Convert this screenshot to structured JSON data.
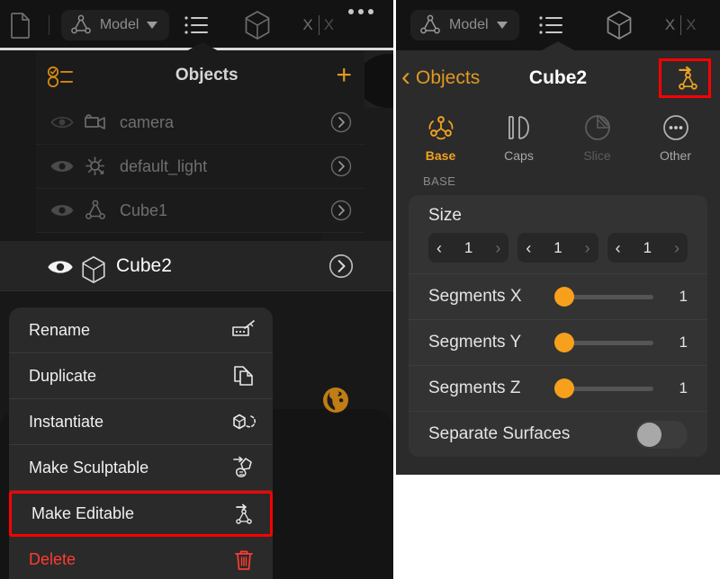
{
  "left": {
    "toolbar": {
      "file_icon": "document-icon",
      "mode_chip": {
        "icon": "mesh-triangle-icon",
        "label": "Model",
        "caret": "chevron-down-icon"
      },
      "list_icon": "list-icon",
      "cube_icon": "cube-icon",
      "mirror_label": "X|X",
      "overflow_icon": "more-dots-icon"
    },
    "objects": {
      "filter_icon": "filter-checklist-icon",
      "title": "Objects",
      "add_label": "+",
      "rows": [
        {
          "name": "camera",
          "type_icon": "camera-icon",
          "eye_icon": "eye-hidden-icon",
          "chevron": "chevron-right-icon",
          "selected": false
        },
        {
          "name": "default_light",
          "type_icon": "light-icon",
          "eye_icon": "eye-icon",
          "chevron": "chevron-right-icon",
          "selected": false
        },
        {
          "name": "Cube1",
          "type_icon": "mesh-triangle-icon",
          "eye_icon": "eye-icon",
          "chevron": "chevron-right-icon",
          "selected": false
        },
        {
          "name": "Cube2",
          "type_icon": "cube-icon",
          "eye_icon": "eye-icon",
          "chevron": "chevron-right-icon",
          "selected": true
        }
      ]
    },
    "globe_icon": "globe-icon",
    "context_menu": {
      "items": [
        {
          "label": "Rename",
          "icon": "rename-icon",
          "highlighted": false,
          "danger": false
        },
        {
          "label": "Duplicate",
          "icon": "duplicate-icon",
          "highlighted": false,
          "danger": false
        },
        {
          "label": "Instantiate",
          "icon": "instantiate-icon",
          "highlighted": false,
          "danger": false
        },
        {
          "label": "Make Sculptable",
          "icon": "sculpt-icon",
          "highlighted": false,
          "danger": false
        },
        {
          "label": "Make Editable",
          "icon": "make-editable-icon",
          "highlighted": true,
          "danger": false
        },
        {
          "label": "Delete",
          "icon": "trash-icon",
          "highlighted": false,
          "danger": true
        }
      ],
      "highlight_color": "#ff0000",
      "danger_color": "#ff3b30"
    }
  },
  "right": {
    "toolbar": {
      "mode_chip": {
        "icon": "mesh-triangle-icon",
        "label": "Model",
        "caret": "chevron-down-icon"
      },
      "list_icon": "list-icon",
      "cube_icon": "cube-icon",
      "mirror_label": "X|X"
    },
    "nav": {
      "back_label": "Objects",
      "back_icon": "chevron-left-icon",
      "title": "Cube2",
      "action_icon": "make-editable-icon",
      "action_highlight_color": "#ff0000"
    },
    "tabs": [
      {
        "label": "Base",
        "icon": "base-node-icon",
        "state": "active"
      },
      {
        "label": "Caps",
        "icon": "caps-icon",
        "state": "normal"
      },
      {
        "label": "Slice",
        "icon": "slice-pie-icon",
        "state": "disabled"
      },
      {
        "label": "Other",
        "icon": "other-dots-icon",
        "state": "normal"
      }
    ],
    "section_label": "BASE",
    "size": {
      "title": "Size",
      "fields": [
        {
          "value": "1",
          "dec_icon": "chevron-left-icon",
          "inc_icon": "chevron-right-icon"
        },
        {
          "value": "1",
          "dec_icon": "chevron-left-icon",
          "inc_icon": "chevron-right-icon"
        },
        {
          "value": "1",
          "dec_icon": "chevron-left-icon",
          "inc_icon": "chevron-right-icon"
        }
      ]
    },
    "properties": [
      {
        "label": "Segments X",
        "value": "1",
        "control": "slider",
        "fill_pct": 0
      },
      {
        "label": "Segments Y",
        "value": "1",
        "control": "slider",
        "fill_pct": 0
      },
      {
        "label": "Segments Z",
        "value": "1",
        "control": "slider",
        "fill_pct": 0
      }
    ],
    "toggle_row": {
      "label": "Separate Surfaces",
      "value": "off"
    }
  },
  "theme": {
    "accent": "#f0a21e",
    "panel_bg": "#2b2b2b",
    "toolbar_bg": "#131313",
    "card_bg": "#333333",
    "slider_knob": "#f7a01b"
  }
}
